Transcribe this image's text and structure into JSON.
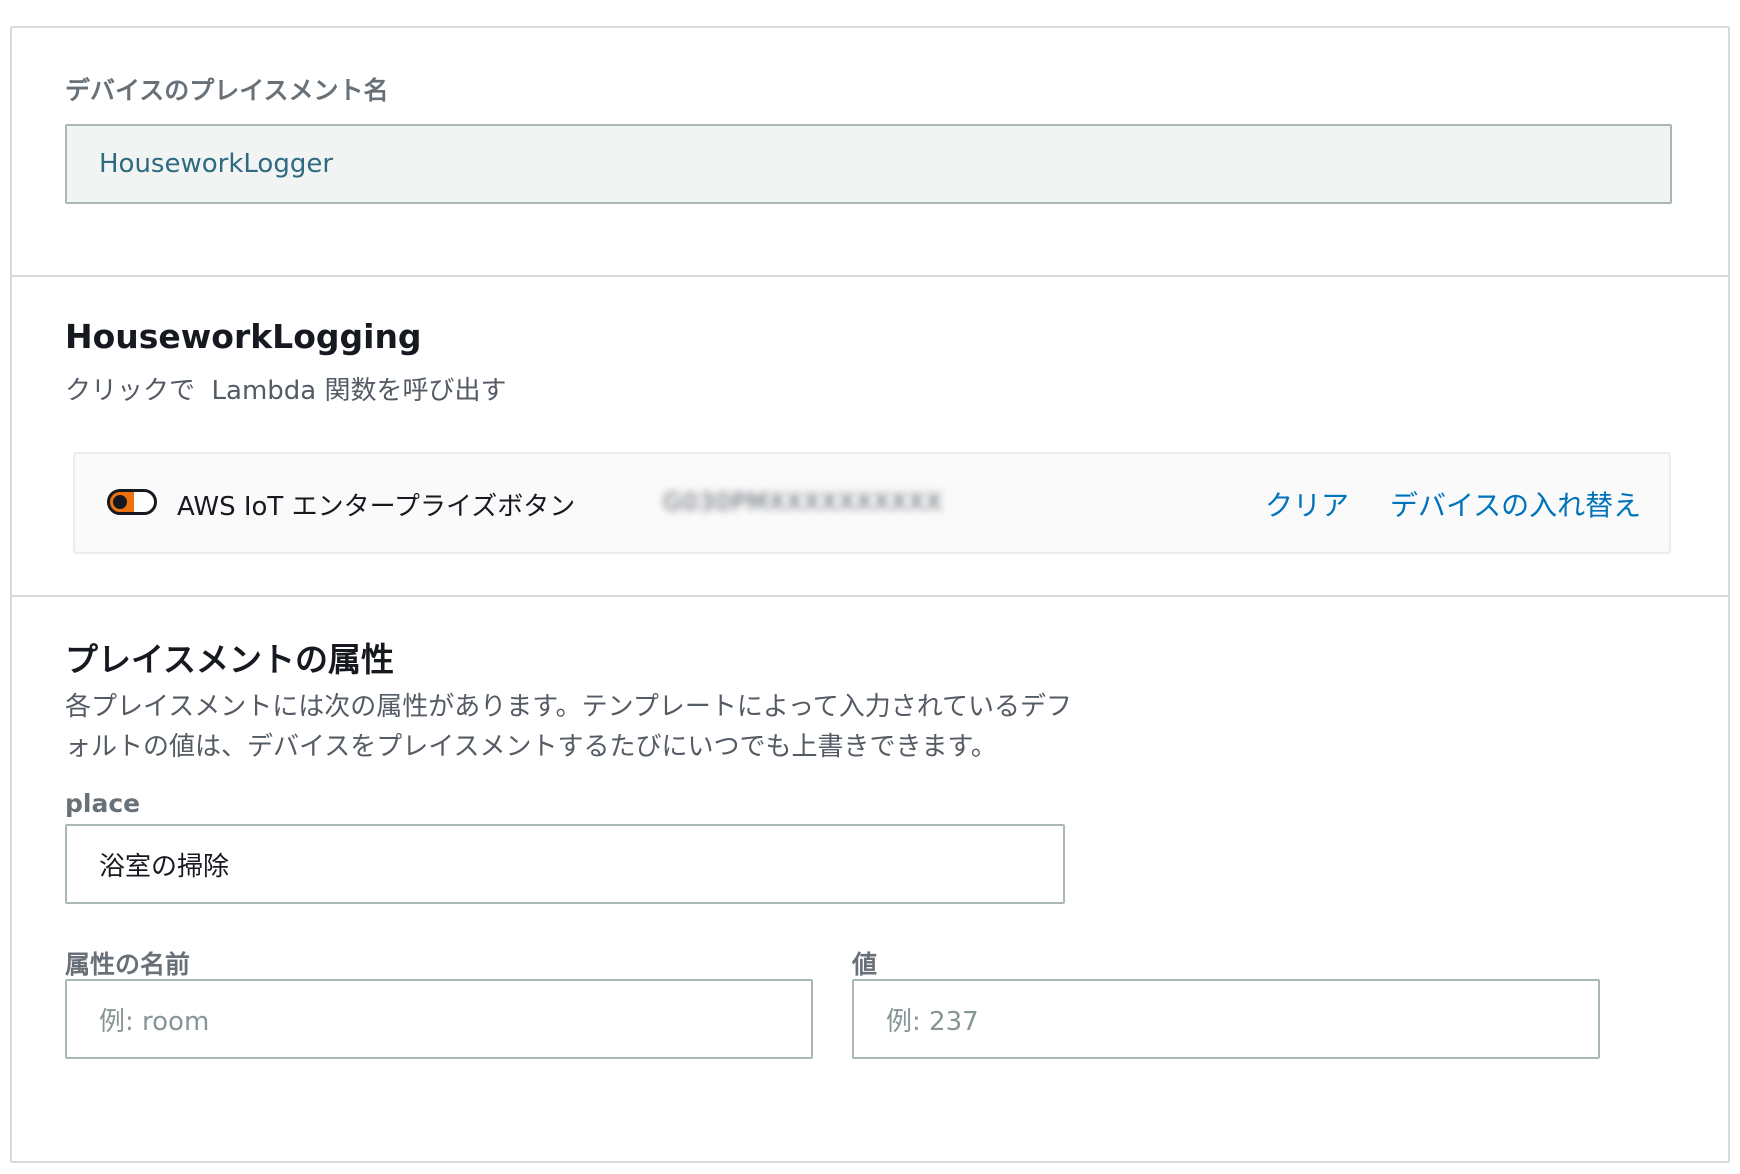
{
  "placement": {
    "label": "デバイスのプレイスメント名",
    "value": "HouseworkLogger"
  },
  "project": {
    "title": "HouseworkLogging",
    "description": "クリックで  Lambda 関数を呼び出す",
    "device": {
      "type_label": "AWS IoT エンタープライズボタン",
      "serial": "G030PMXXXXXXXXXX",
      "clear_label": "クリア",
      "replace_label": "デバイスの入れ替え"
    }
  },
  "attributes": {
    "title": "プレイスメントの属性",
    "description_line1": "各プレイスメントには次の属性があります。テンプレートによって入力されているデフ",
    "description_line2": "ォルトの値は、デバイスをプレイスメントするたびにいつでも上書きできます。",
    "place_label": "place",
    "place_value": "浴室の掃除",
    "name_label": "属性の名前",
    "name_placeholder": "例: room",
    "value_label": "値",
    "value_placeholder": "例: 237"
  },
  "colors": {
    "link": "#0073bb",
    "toggle_accent": "#ec7211"
  }
}
